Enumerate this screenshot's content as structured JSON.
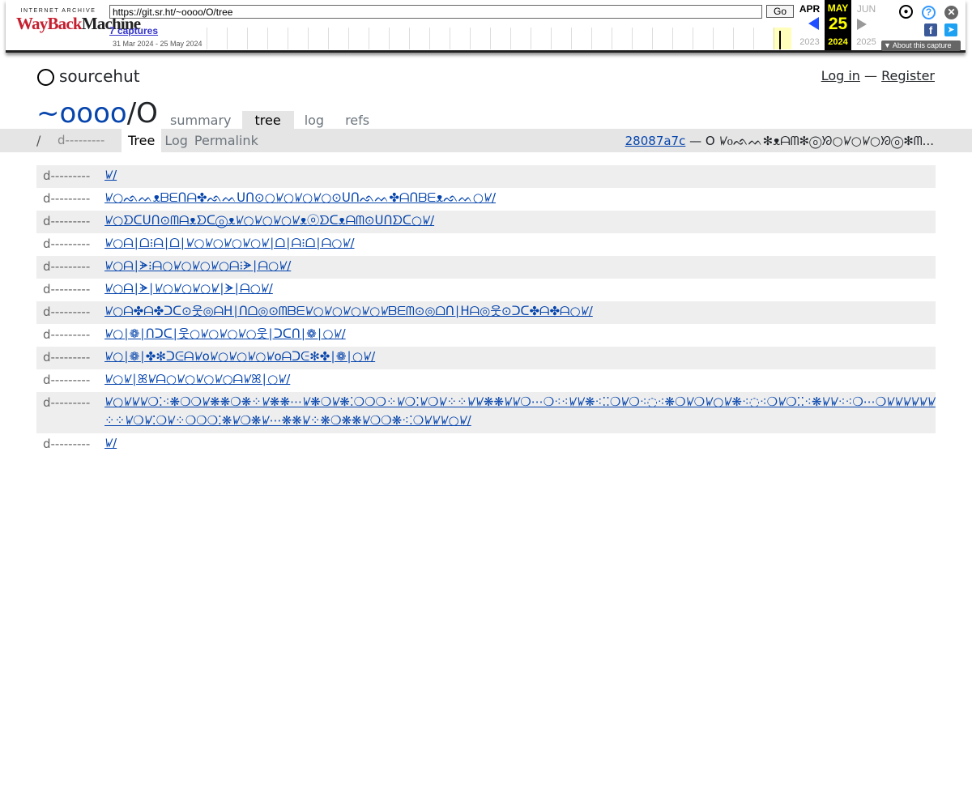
{
  "wayback": {
    "logo_top": "INTERNET ARCHIVE",
    "logo_red": "WayBack",
    "logo_black": "Machine",
    "url": "https://git.sr.ht/~oooo/O/tree",
    "go_label": "Go",
    "captures": "7 captures",
    "range": "31 Mar 2024 - 25 May 2024",
    "months": {
      "prev": "APR",
      "current": "MAY",
      "next": "JUN"
    },
    "day": "25",
    "years": {
      "prev": "2023",
      "current": "2024",
      "next": "2025"
    },
    "about": "About this capture",
    "icons": [
      "user-icon",
      "help-icon",
      "close-icon",
      "facebook-icon",
      "twitter-icon"
    ],
    "colors": {
      "accent": "#2050ff",
      "logo_red": "#c52030",
      "highlight": "#ffff00"
    }
  },
  "header": {
    "brand": "sourcehut",
    "login": "Log in",
    "separator": "—",
    "register": "Register"
  },
  "repo": {
    "owner": "~oooo",
    "slash": "/",
    "name": "O",
    "tabs": [
      "summary",
      "tree",
      "log",
      "refs"
    ],
    "active_tab": "tree"
  },
  "subnav": {
    "path": "/",
    "perms": "d---------",
    "tabs": [
      "Tree",
      "Log",
      "Permalink"
    ],
    "commit_hash": "28087a7c",
    "commit_message": "— O ꤿ᧐ᨒᨓ✻ᴥᗩᗰ✻ⓞᘞ○ꤿ○ꤿ○ᘞⓞ✻ᗰ..."
  },
  "tree": [
    {
      "mode": "d---------",
      "name": "ꤿ/"
    },
    {
      "mode": "d---------",
      "name": "ꤿ○ᨒᨓᴥᗷᗴᑎᗩ✤ᨒᨓᑌᑎ⊙○ꤿ○ꤿ○ꤿ○⊙ᑌᑎᨒᨓ✤ᗩᑎᗷᗴᴥᨒᨓ○ꤿ/"
    },
    {
      "mode": "d---------",
      "name": "ꤿ○ᗤᑕᑌᑎ⊙ᗰᗩᴥᗤᑕⓞᴥꤿ○ꤿ○ꤿ○ꤿᴥⓞᗤᑕᴥᗩᗰ⊙ᑌᑎᗤᑕ○ꤿ/"
    },
    {
      "mode": "d---------",
      "name": "ꤿ○ᗩ∣ᗝ⁝ᗩ∣ᗝ∣ꤿ○ꤿ○ꤿ○ꤿ○ꤿ∣ᗝ∣ᗩ⁝ᗝ∣ᗩ○ꤿ/"
    },
    {
      "mode": "d---------",
      "name": "ꤿ○ᗩ∣ᗘ⁝ᗩ○ꤿ○ꤿ○ꤿ○ᗩ⁝ᗘ∣ᗩ○ꤿ/"
    },
    {
      "mode": "d---------",
      "name": "ꤿ○ᗩ∣ᗘ∣ꤿ○ꤿ○ꤿ○ꤿ∣ᗘ∣ᗩ○ꤿ/"
    },
    {
      "mode": "d---------",
      "name": "ꤿ○ᗩ✤ᗩ✤ᑐᑕ⊙웃◎ᗩᕼ∣ᑎᗝ◎⊙ᗰᗷᗴꤿ○ꤿ○ꤿ○ꤿ○ꤿᗷᗴᗰ⊙◎ᗝᑎ∣ᕼᗩ◎웃⊙ᑐᑕ✤ᗩ✤ᗩ○ꤿ/"
    },
    {
      "mode": "d---------",
      "name": "ꤿ○∣❁∣ᑎᑐᑕ∣웃○ꤿ○ꤿ○ꤿ○웃∣ᑐᑕᑎ∣❁∣○ꤿ/"
    },
    {
      "mode": "d---------",
      "name": "ꤿ○∣❁∣✤✻ᑐᕮᗩꤿoꤿ○ꤿ○ꤿ○ꤿoᗩᑐᕮ✻✤∣❁∣○ꤿ/"
    },
    {
      "mode": "d---------",
      "name": "ꤿ○ꤿ∣ꕤꤿᗩ○ꤿ○ꤿ○ꤿ○ᗩꤿꕤ∣○ꤿ/"
    },
    {
      "mode": "d---------",
      "name": "ꤿ○ꤿꤿꤿ❍⁚⁖❋❍❍ꤿ❋❋❍❋⁘ꤿ❋❋⋯ꤿ❋❍ꤿ❋⁚❍❍❍⁘ꤿ❍⁚ꤿ❍ꤿ⁘⁘ꤿꤿ❋❋ꤿꤿ❍⋯❍⁖⁖ꤿꤿ❋⁖⁚⁚❍ꤿ❍⁖◌⁖❋❍ꤿ❍ꤿ○ꤿ❋⁖◌⁖❍ꤿ❍⁚⁚⁖❋ꤿꤿ⁖⁖❍⋯❍ꤿꤿꤿꤿꤿꤿ⁘⁘ꤿ❍ꤿ⁚❍ꤿ⁘❍❍❍⁚❋ꤿ❍❋ꤿ⋯❋❋ꤿ⁘❋❍❋❋ꤿ❍❍❋⁖⁚❍ꤿꤿꤿ○ꤿ/"
    },
    {
      "mode": "d---------",
      "name": "ꤿ/"
    }
  ]
}
